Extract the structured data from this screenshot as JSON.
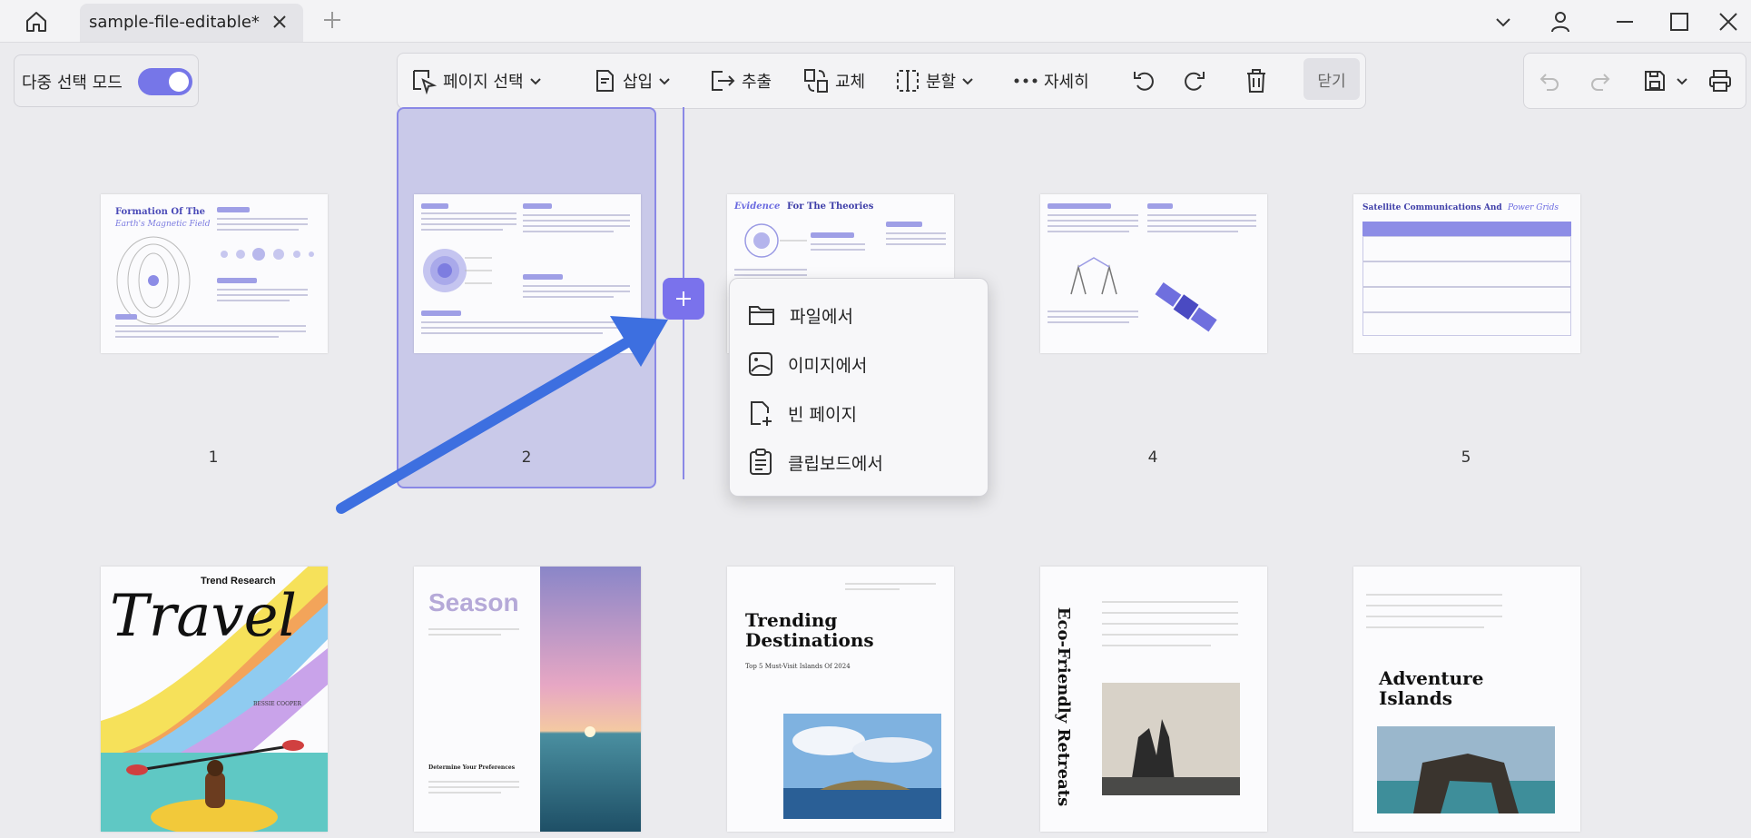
{
  "tab": {
    "title": "sample-file-editable*"
  },
  "multi_select": {
    "label": "다중 선택 모드",
    "enabled": true
  },
  "toolbar": {
    "select_pages": "페이지 선택",
    "insert": "삽입",
    "extract": "추출",
    "replace": "교체",
    "split": "분할",
    "more": "자세히",
    "close": "닫기"
  },
  "insert_menu": {
    "from_file": "파일에서",
    "from_image": "이미지에서",
    "blank_page": "빈 페이지",
    "from_clipboard": "클립보드에서"
  },
  "pages": {
    "n1": "1",
    "n2": "2",
    "n4": "4",
    "n5": "5",
    "p1_title_a": "Formation Of The",
    "p1_title_b": "Earth's Magnetic Field",
    "p3_title_a": "Evidence",
    "p3_title_b": "For The Theories",
    "p5_title_a": "Satellite Communications And",
    "p5_title_b": "Power Grids",
    "p6_title": "Travel",
    "p6_subtitle": "Trend Research",
    "p6_author": "BESSIE COOPER",
    "p7_title": "Season",
    "p7_heading": "Determine Your Preferences",
    "p8_title_a": "Trending",
    "p8_title_b": "Destinations",
    "p8_sub": "Top 5 Must-Visit Islands Of 2024",
    "p9_title": "Eco-Friendly Retreats",
    "p10_title_a": "Adventure",
    "p10_title_b": "Islands"
  },
  "colors": {
    "accent": "#7676e8",
    "selection": "#8a88e6",
    "arrow": "#3d6fe0"
  },
  "icons": [
    "home-icon",
    "close-icon",
    "plus-icon",
    "minimize-icon",
    "maximize-icon",
    "user-icon",
    "undo-icon",
    "redo-icon",
    "save-icon",
    "print-icon",
    "trash-icon",
    "rotate-left-icon",
    "rotate-right-icon",
    "folder-icon",
    "image-icon",
    "blank-page-icon",
    "clipboard-icon"
  ]
}
